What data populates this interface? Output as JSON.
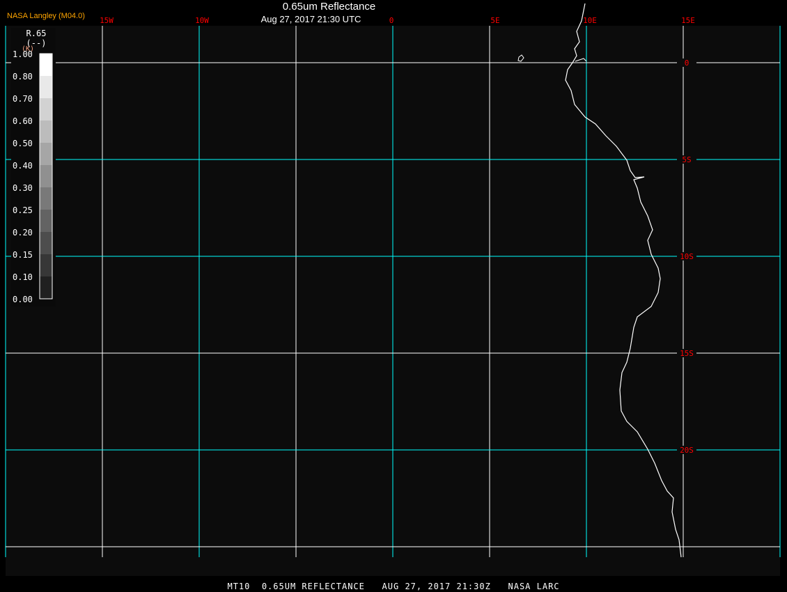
{
  "header": {
    "title": "0.65um Reflectance",
    "subtitle": "Aug 27, 2017 21:30 UTC",
    "brand": "NASA Langley (M04.0)"
  },
  "footer": "MT10  0.65UM REFLECTANCE   AUG 27, 2017 21:30Z   NASA LARC",
  "map": {
    "lon_labels": [
      "15W",
      "10W",
      "0",
      "5E",
      "10E",
      "15E"
    ],
    "lat_labels": [
      "0",
      "5S",
      "10S",
      "15S",
      "20S"
    ],
    "grid_color_primary": "#00ffff",
    "grid_color_secondary": "#ffffff",
    "label_color": "#ff0000",
    "coastline_color": "#ffffff"
  },
  "colorbar": {
    "variable": "R.65",
    "units": "(--)",
    "extra": "(K)",
    "ticks": [
      "1.00",
      "0.80",
      "0.70",
      "0.60",
      "0.50",
      "0.40",
      "0.30",
      "0.25",
      "0.20",
      "0.15",
      "0.10",
      "0.00"
    ]
  }
}
